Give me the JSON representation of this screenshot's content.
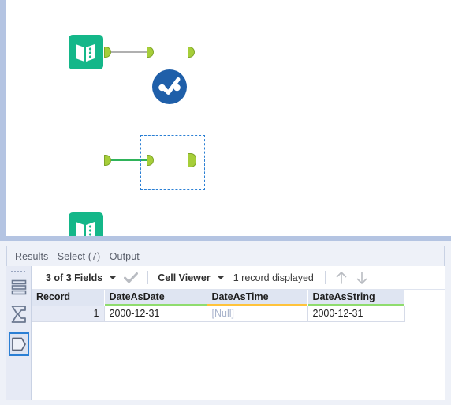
{
  "canvas": {
    "nodes": [
      {
        "id": "input-1",
        "type": "input-data-tool",
        "icon": "book-icon",
        "color": "#14b789",
        "selected": false
      },
      {
        "id": "select-1",
        "type": "select-tool",
        "icon": "check-circle-icon",
        "color": "#1f5fa9",
        "selected": false
      },
      {
        "id": "input-2",
        "type": "input-data-tool",
        "icon": "book-icon",
        "color": "#14b789",
        "selected": false
      },
      {
        "id": "select-2",
        "type": "select-tool",
        "icon": "check-circle-icon",
        "color": "#1f5fa9",
        "selected": true
      }
    ],
    "connections": [
      {
        "from": "input-1",
        "to": "select-1",
        "color": "#b0b0b0"
      },
      {
        "from": "input-2",
        "to": "select-2",
        "color": "#2fb35a"
      }
    ],
    "anchor_color": "#a6ce39",
    "selection_color": "#2a7fd4"
  },
  "results": {
    "title": "Results - Select (7) - Output",
    "rail": {
      "items": [
        {
          "name": "data-grid-icon",
          "label": "Data",
          "selected": false
        },
        {
          "name": "profile-sigma-icon",
          "label": "Profile",
          "selected": false
        },
        {
          "name": "messages-icon",
          "label": "Messages",
          "selected": true
        }
      ]
    },
    "toolbar": {
      "fields_label": "3 of 3 Fields",
      "check_icon": "checkmark-icon",
      "caret_icon": "chevron-down-icon",
      "viewer_label": "Cell Viewer",
      "records_label": "1 record displayed",
      "up_arrow_icon": "arrow-up-icon",
      "down_arrow_icon": "arrow-down-icon"
    },
    "grid": {
      "columns": [
        {
          "header": "Record",
          "type_color": ""
        },
        {
          "header": "DateAsDate",
          "type_color": "#8fdc6e"
        },
        {
          "header": "DateAsTime",
          "type_color": "#ffc33b"
        },
        {
          "header": "DateAsString",
          "type_color": "#8fdc6e"
        }
      ],
      "rows": [
        {
          "record": "1",
          "DateAsDate": "2000-12-31",
          "DateAsTime": "[Null]",
          "DateAsString": "2000-12-31"
        }
      ]
    }
  }
}
